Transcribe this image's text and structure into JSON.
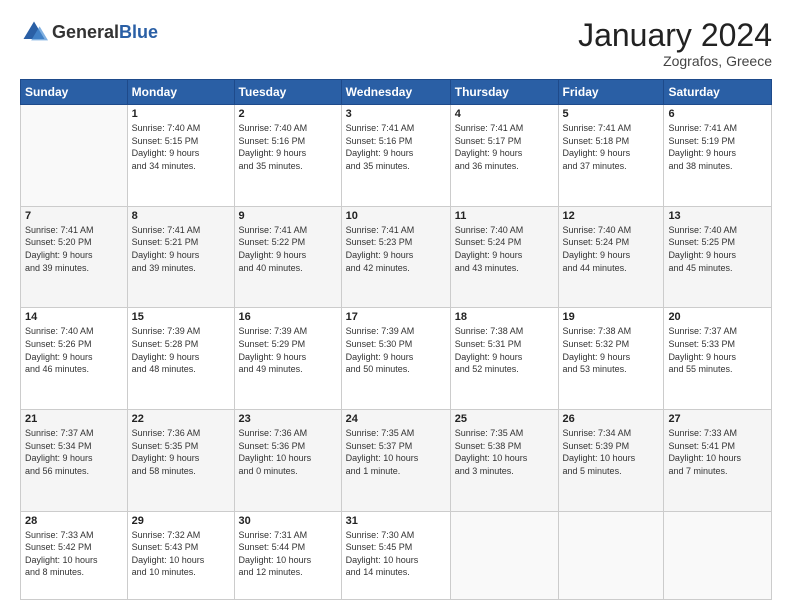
{
  "header": {
    "logo_general": "General",
    "logo_blue": "Blue",
    "month_title": "January 2024",
    "location": "Zografos, Greece"
  },
  "weekdays": [
    "Sunday",
    "Monday",
    "Tuesday",
    "Wednesday",
    "Thursday",
    "Friday",
    "Saturday"
  ],
  "weeks": [
    [
      {
        "day": "",
        "info": ""
      },
      {
        "day": "1",
        "info": "Sunrise: 7:40 AM\nSunset: 5:15 PM\nDaylight: 9 hours\nand 34 minutes."
      },
      {
        "day": "2",
        "info": "Sunrise: 7:40 AM\nSunset: 5:16 PM\nDaylight: 9 hours\nand 35 minutes."
      },
      {
        "day": "3",
        "info": "Sunrise: 7:41 AM\nSunset: 5:16 PM\nDaylight: 9 hours\nand 35 minutes."
      },
      {
        "day": "4",
        "info": "Sunrise: 7:41 AM\nSunset: 5:17 PM\nDaylight: 9 hours\nand 36 minutes."
      },
      {
        "day": "5",
        "info": "Sunrise: 7:41 AM\nSunset: 5:18 PM\nDaylight: 9 hours\nand 37 minutes."
      },
      {
        "day": "6",
        "info": "Sunrise: 7:41 AM\nSunset: 5:19 PM\nDaylight: 9 hours\nand 38 minutes."
      }
    ],
    [
      {
        "day": "7",
        "info": "Sunrise: 7:41 AM\nSunset: 5:20 PM\nDaylight: 9 hours\nand 39 minutes."
      },
      {
        "day": "8",
        "info": "Sunrise: 7:41 AM\nSunset: 5:21 PM\nDaylight: 9 hours\nand 39 minutes."
      },
      {
        "day": "9",
        "info": "Sunrise: 7:41 AM\nSunset: 5:22 PM\nDaylight: 9 hours\nand 40 minutes."
      },
      {
        "day": "10",
        "info": "Sunrise: 7:41 AM\nSunset: 5:23 PM\nDaylight: 9 hours\nand 42 minutes."
      },
      {
        "day": "11",
        "info": "Sunrise: 7:40 AM\nSunset: 5:24 PM\nDaylight: 9 hours\nand 43 minutes."
      },
      {
        "day": "12",
        "info": "Sunrise: 7:40 AM\nSunset: 5:24 PM\nDaylight: 9 hours\nand 44 minutes."
      },
      {
        "day": "13",
        "info": "Sunrise: 7:40 AM\nSunset: 5:25 PM\nDaylight: 9 hours\nand 45 minutes."
      }
    ],
    [
      {
        "day": "14",
        "info": "Sunrise: 7:40 AM\nSunset: 5:26 PM\nDaylight: 9 hours\nand 46 minutes."
      },
      {
        "day": "15",
        "info": "Sunrise: 7:39 AM\nSunset: 5:28 PM\nDaylight: 9 hours\nand 48 minutes."
      },
      {
        "day": "16",
        "info": "Sunrise: 7:39 AM\nSunset: 5:29 PM\nDaylight: 9 hours\nand 49 minutes."
      },
      {
        "day": "17",
        "info": "Sunrise: 7:39 AM\nSunset: 5:30 PM\nDaylight: 9 hours\nand 50 minutes."
      },
      {
        "day": "18",
        "info": "Sunrise: 7:38 AM\nSunset: 5:31 PM\nDaylight: 9 hours\nand 52 minutes."
      },
      {
        "day": "19",
        "info": "Sunrise: 7:38 AM\nSunset: 5:32 PM\nDaylight: 9 hours\nand 53 minutes."
      },
      {
        "day": "20",
        "info": "Sunrise: 7:37 AM\nSunset: 5:33 PM\nDaylight: 9 hours\nand 55 minutes."
      }
    ],
    [
      {
        "day": "21",
        "info": "Sunrise: 7:37 AM\nSunset: 5:34 PM\nDaylight: 9 hours\nand 56 minutes."
      },
      {
        "day": "22",
        "info": "Sunrise: 7:36 AM\nSunset: 5:35 PM\nDaylight: 9 hours\nand 58 minutes."
      },
      {
        "day": "23",
        "info": "Sunrise: 7:36 AM\nSunset: 5:36 PM\nDaylight: 10 hours\nand 0 minutes."
      },
      {
        "day": "24",
        "info": "Sunrise: 7:35 AM\nSunset: 5:37 PM\nDaylight: 10 hours\nand 1 minute."
      },
      {
        "day": "25",
        "info": "Sunrise: 7:35 AM\nSunset: 5:38 PM\nDaylight: 10 hours\nand 3 minutes."
      },
      {
        "day": "26",
        "info": "Sunrise: 7:34 AM\nSunset: 5:39 PM\nDaylight: 10 hours\nand 5 minutes."
      },
      {
        "day": "27",
        "info": "Sunrise: 7:33 AM\nSunset: 5:41 PM\nDaylight: 10 hours\nand 7 minutes."
      }
    ],
    [
      {
        "day": "28",
        "info": "Sunrise: 7:33 AM\nSunset: 5:42 PM\nDaylight: 10 hours\nand 8 minutes."
      },
      {
        "day": "29",
        "info": "Sunrise: 7:32 AM\nSunset: 5:43 PM\nDaylight: 10 hours\nand 10 minutes."
      },
      {
        "day": "30",
        "info": "Sunrise: 7:31 AM\nSunset: 5:44 PM\nDaylight: 10 hours\nand 12 minutes."
      },
      {
        "day": "31",
        "info": "Sunrise: 7:30 AM\nSunset: 5:45 PM\nDaylight: 10 hours\nand 14 minutes."
      },
      {
        "day": "",
        "info": ""
      },
      {
        "day": "",
        "info": ""
      },
      {
        "day": "",
        "info": ""
      }
    ]
  ]
}
